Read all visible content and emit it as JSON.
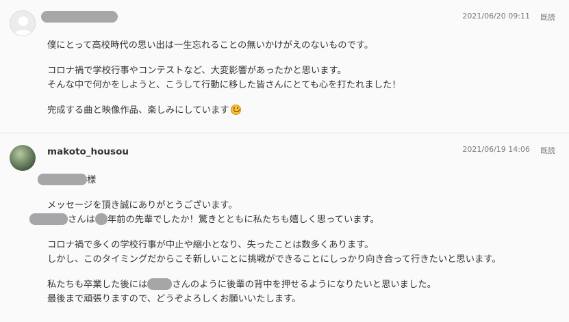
{
  "messages": [
    {
      "author": "",
      "timestamp": "2021/06/20 09:11",
      "status": "既読",
      "paragraphs": [
        [
          "僕にとって高校時代の思い出は一生忘れることの無いかけがえのないものです。"
        ],
        [
          "コロナ禍で学校行事やコンテストなど、大変影響があったかと思います。",
          "そんな中で何かをしようと、こうして行動に移した皆さんにとても心を打たれました！"
        ],
        [
          "完成する曲と映像作品、楽しみにしています"
        ]
      ],
      "emoji": "smiling-face-icon"
    },
    {
      "author": "makoto_housou",
      "timestamp": "2021/06/19 14:06",
      "status": "既読",
      "greeting_suffix": "様",
      "p2_l1": "メッセージを頂き誠にありがとうございます。",
      "p2_l2a": "さんは",
      "p2_l2b": "年前の先輩でしたか！驚きとともに私たちも嬉しく思っています。",
      "p3_l1": "コロナ禍で多くの学校行事が中止や縮小となり、失ったことは数多くあります。",
      "p3_l2": "しかし、このタイミングだからこそ新しいことに挑戦ができることにしっかり向き合って行きたいと思います。",
      "p4_l1a": "私たちも卒業した後には",
      "p4_l1b": "さんのように後輩の背中を押せるようになりたいと思いました。",
      "p4_l2": "最後まで頑張りますので、どうぞよろしくお願いいたします。"
    }
  ]
}
